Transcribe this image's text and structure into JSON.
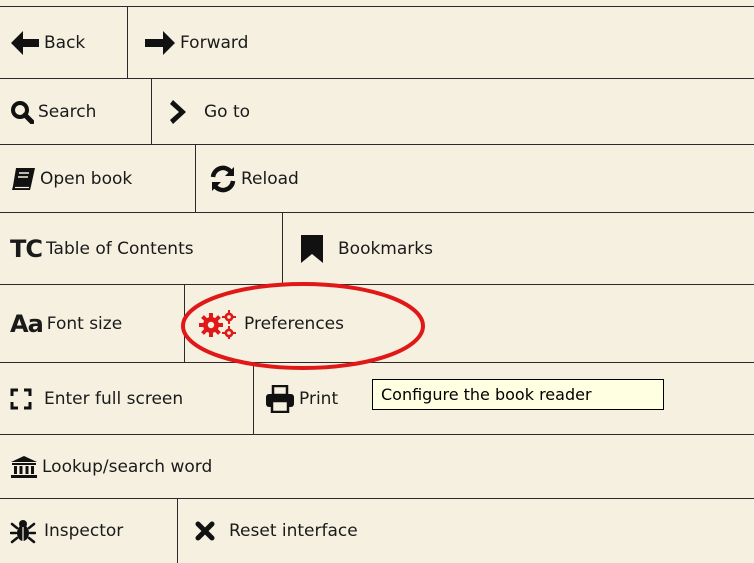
{
  "rows": {
    "nav": {
      "back_label": "Back",
      "forward_label": "Forward"
    },
    "search": {
      "search_label": "Search",
      "goto_label": "Go to"
    },
    "book": {
      "open_label": "Open book",
      "reload_label": "Reload"
    },
    "toc": {
      "toc_icon_text": "TC",
      "toc_label": "Table of Contents",
      "bookmarks_label": "Bookmarks"
    },
    "font": {
      "font_icon_text": "Aa",
      "font_label": "Font size",
      "prefs_label": "Preferences"
    },
    "screen": {
      "fullscreen_label": "Enter full screen",
      "print_label": "Print"
    },
    "lookup": {
      "lookup_label": "Lookup/search word"
    },
    "inspect": {
      "inspector_label": "Inspector",
      "reset_label": "Reset interface"
    }
  },
  "tooltip": {
    "text": "Configure the book reader"
  },
  "colors": {
    "background": "#f5f0e0",
    "border": "#2a2a2a",
    "accent_red": "#e01818",
    "tooltip_bg": "#ffffe1"
  }
}
